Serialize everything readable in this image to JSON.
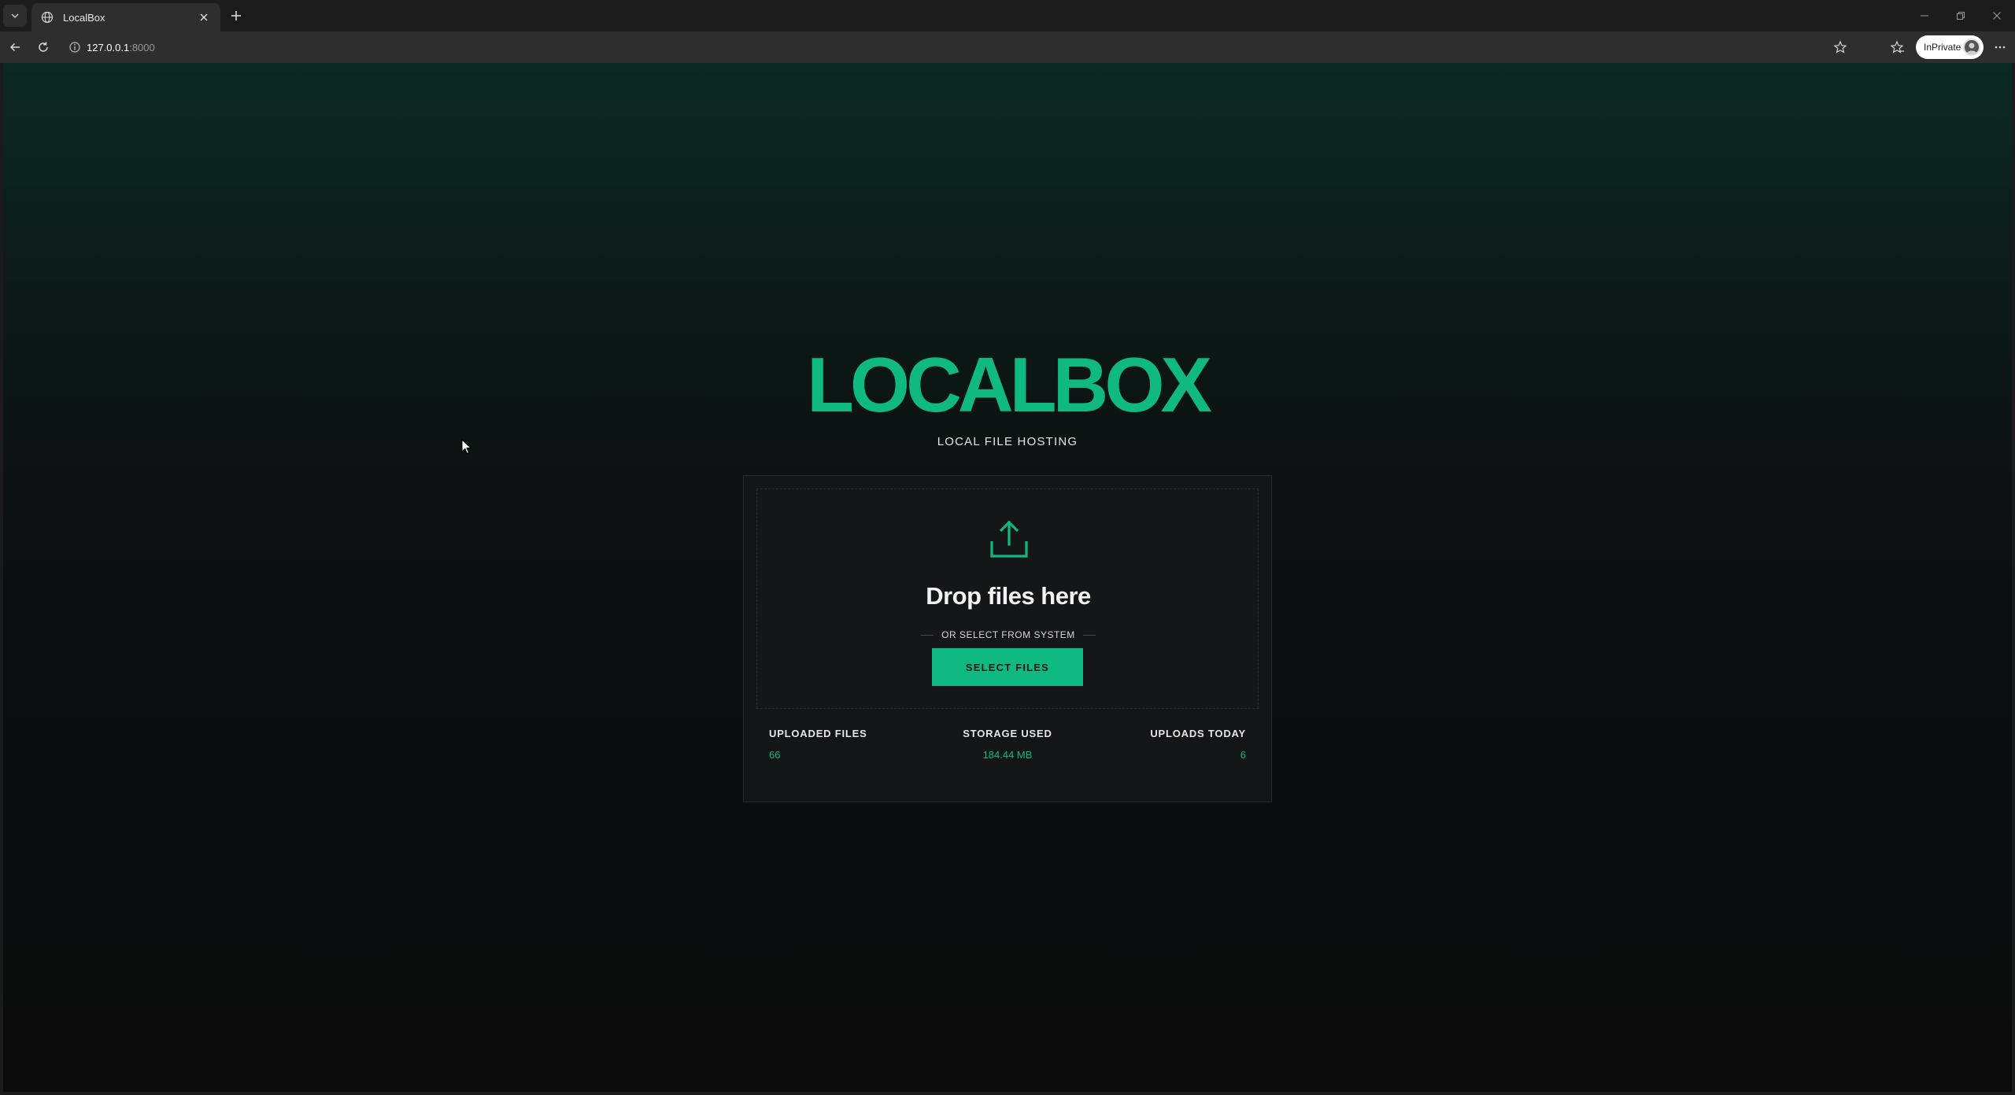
{
  "browser": {
    "tab": {
      "title": "LocalBox"
    },
    "address": {
      "host": "127.0.0.1",
      "port": ":8000"
    },
    "profile_badge": "InPrivate"
  },
  "page": {
    "brand": "LOCALBOX",
    "tagline": "LOCAL FILE HOSTING",
    "dropzone": {
      "title": "Drop files here",
      "divider_text": "OR SELECT FROM SYSTEM",
      "button_label": "SELECT FILES"
    },
    "stats": [
      {
        "label": "UPLOADED FILES",
        "value": "66"
      },
      {
        "label": "STORAGE USED",
        "value": "184.44 MB"
      },
      {
        "label": "UPLOADS TODAY",
        "value": "6"
      }
    ]
  },
  "colors": {
    "accent": "#10b981",
    "card_background": "#141516",
    "chrome_background": "#1c1c1c"
  }
}
